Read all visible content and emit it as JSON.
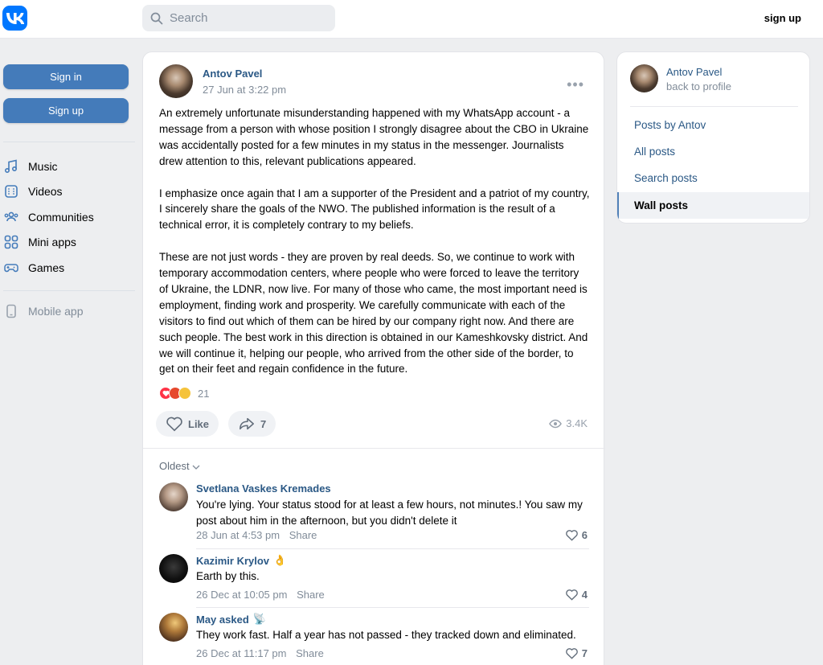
{
  "header": {
    "search_placeholder": "Search",
    "signup_label": "sign up"
  },
  "sidebar": {
    "signin_label": "Sign in",
    "signup_label": "Sign up",
    "items": [
      {
        "label": "Music",
        "icon": "music-icon"
      },
      {
        "label": "Videos",
        "icon": "video-icon"
      },
      {
        "label": "Communities",
        "icon": "communities-icon"
      },
      {
        "label": "Mini apps",
        "icon": "mini-apps-icon"
      },
      {
        "label": "Games",
        "icon": "games-icon"
      }
    ],
    "mobile_app_label": "Mobile app"
  },
  "post": {
    "author": "Antov Pavel",
    "date": "27 Jun at 3:22 pm",
    "paragraphs": [
      "An extremely unfortunate misunderstanding happened with my WhatsApp account - a message from a person with whose position I strongly disagree about the CBO in Ukraine was accidentally posted for a few minutes in my status in the messenger. Journalists drew attention to this, relevant publications appeared.",
      "I emphasize once again that I am a supporter of the President and a patriot of my country, I sincerely share the goals of the NWO. The published information is the result of a technical error, it is completely contrary to my beliefs.",
      "These are not just words - they are proven by real deeds. So, we continue to work with temporary accommodation centers, where people who were forced to leave the territory of Ukraine, the LDNR, now live. For many of those who came, the most important need is employment, finding work and prosperity. We carefully communicate with each of the visitors to find out which of them can be hired by our company right now. And there are such people. The best work in this direction is obtained in our Kameshkovsky district. And we will continue it, helping our people, who arrived from the other side of the border, to get on their feet and regain confidence in the future."
    ],
    "reactions_count": "21",
    "like_label": "Like",
    "share_count": "7",
    "views": "3.4K"
  },
  "comments": {
    "sort_label": "Oldest",
    "items": [
      {
        "name": "Svetlana Vaskes Kremades",
        "text": "You're lying. Your status stood for at least a few hours, not minutes.! You saw my post about him in the afternoon, but you didn't delete it",
        "date": "28 Jun at 4:53 pm",
        "share": "Share",
        "likes": "6",
        "emoji": ""
      },
      {
        "name": "Kazimir Krylov",
        "text": "Earth by this.",
        "date": "26 Dec at 10:05 pm",
        "share": "Share",
        "likes": "4",
        "emoji": "👌"
      },
      {
        "name": "May asked",
        "text": "They work fast. Half a year has not passed - they tracked down and eliminated.",
        "date": "26 Dec at 11:17 pm",
        "share": "Share",
        "likes": "7",
        "emoji": "📡"
      }
    ]
  },
  "right_panel": {
    "name": "Antov Pavel",
    "back_label": "back to profile",
    "links": [
      "Posts by Antov",
      "All posts",
      "Search posts",
      "Wall posts"
    ]
  },
  "colors": {
    "accent": "#0077ff",
    "link": "#2a5885",
    "button": "#447bba"
  }
}
